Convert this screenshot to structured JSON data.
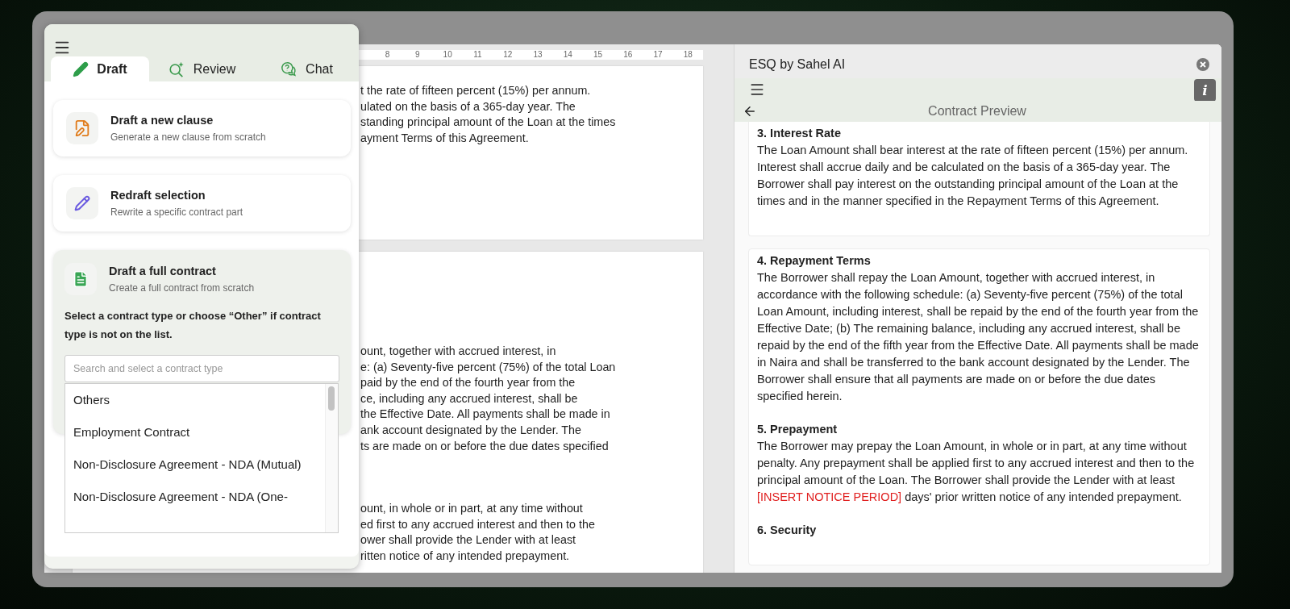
{
  "assistant_panel": {
    "tabs": [
      {
        "kind": "draft",
        "label": "Draft",
        "selected": true
      },
      {
        "kind": "review",
        "label": "Review",
        "selected": false
      },
      {
        "kind": "chat",
        "label": "Chat",
        "selected": false
      }
    ],
    "options": [
      {
        "kind": "clause",
        "title": "Draft a new clause",
        "subtitle": "Generate a new clause from scratch",
        "expanded": false
      },
      {
        "kind": "redraft",
        "title": "Redraft selection",
        "subtitle": "Rewrite a specific contract part",
        "expanded": false
      },
      {
        "kind": "contract",
        "title": "Draft a full contract",
        "subtitle": "Create a full contract from scratch",
        "expanded": true
      }
    ],
    "contract_picker": {
      "instruction": "Select a contract type or choose “Other” if contract type is not on the list.",
      "search": {
        "placeholder": "Search and select a contract type"
      },
      "choices": [
        "Others",
        "Employment Contract",
        "Non-Disclosure Agreement - NDA (Mutual)",
        "Non-Disclosure Agreement - NDA (One-"
      ]
    }
  },
  "document": {
    "ruler": [
      "8",
      "9",
      "10",
      "11",
      "12",
      "13",
      "14",
      "15",
      "16",
      "17",
      "18"
    ],
    "pages": [
      {
        "paragraphs": [
          [
            "t the rate of fifteen percent (15%) per annum.",
            "ulated on the basis of a 365-day year. The",
            "standing principal amount of the Loan at the times",
            "ayment Terms of this Agreement."
          ]
        ]
      },
      {
        "paragraphs": [
          [
            "ount, together with accrued interest, in",
            "e: (a) Seventy-five percent (75%) of the total Loan",
            "paid by the end of the fourth year from the",
            "ce, including any accrued interest, shall be",
            "the Effective Date. All payments shall be made in",
            "ank account designated by the Lender. The",
            "ts are made on or before the due dates specified"
          ],
          [
            "ount, in whole or in part, at any time without",
            "ed first to any accrued interest and then to the",
            "ower shall provide the Lender with at least",
            "ritten notice of any intended prepayment."
          ]
        ]
      }
    ]
  },
  "preview": {
    "title": "ESQ by Sahel AI",
    "info_label": "i",
    "heading": "Contract Preview",
    "cards": [
      {
        "sections": [
          {
            "heading": "3. Interest Rate",
            "body": [
              {
                "text": "The Loan Amount shall bear interest at the rate of fifteen percent (15%) per annum. Interest shall accrue daily and be calculated on the basis of a 365-day year. The Borrower shall pay interest on the outstanding principal amount of the Loan at the times and in the manner specified in the Repayment Terms of this Agreement.",
                "placeholder": false
              }
            ]
          }
        ]
      },
      {
        "sections": [
          {
            "heading": "4. Repayment Terms",
            "body": [
              {
                "text": "The Borrower shall repay the Loan Amount, together with accrued interest, in accordance with the following schedule: (a) Seventy-five percent (75%) of the total Loan Amount, including interest, shall be repaid by the end of the fourth year from the Effective Date; (b) The remaining balance, including any accrued interest, shall be repaid by the end of the fifth year from the Effective Date. All payments shall be made in Naira and shall be transferred to the bank account designated by the Lender. The Borrower shall ensure that all payments are made on or before the due dates specified herein.",
                "placeholder": false
              }
            ]
          },
          {
            "heading": "5. Prepayment",
            "body": [
              {
                "text": "The Borrower may prepay the Loan Amount, in whole or in part, at any time without penalty. Any prepayment shall be applied first to any accrued interest and then to the principal amount of the Loan. The Borrower shall provide the Lender with at least ",
                "placeholder": false
              },
              {
                "text": "[INSERT NOTICE PERIOD]",
                "placeholder": true
              },
              {
                "text": " days' prior written notice of any intended prepayment.",
                "placeholder": false
              }
            ]
          },
          {
            "heading": "6. Security"
          }
        ]
      }
    ]
  }
}
